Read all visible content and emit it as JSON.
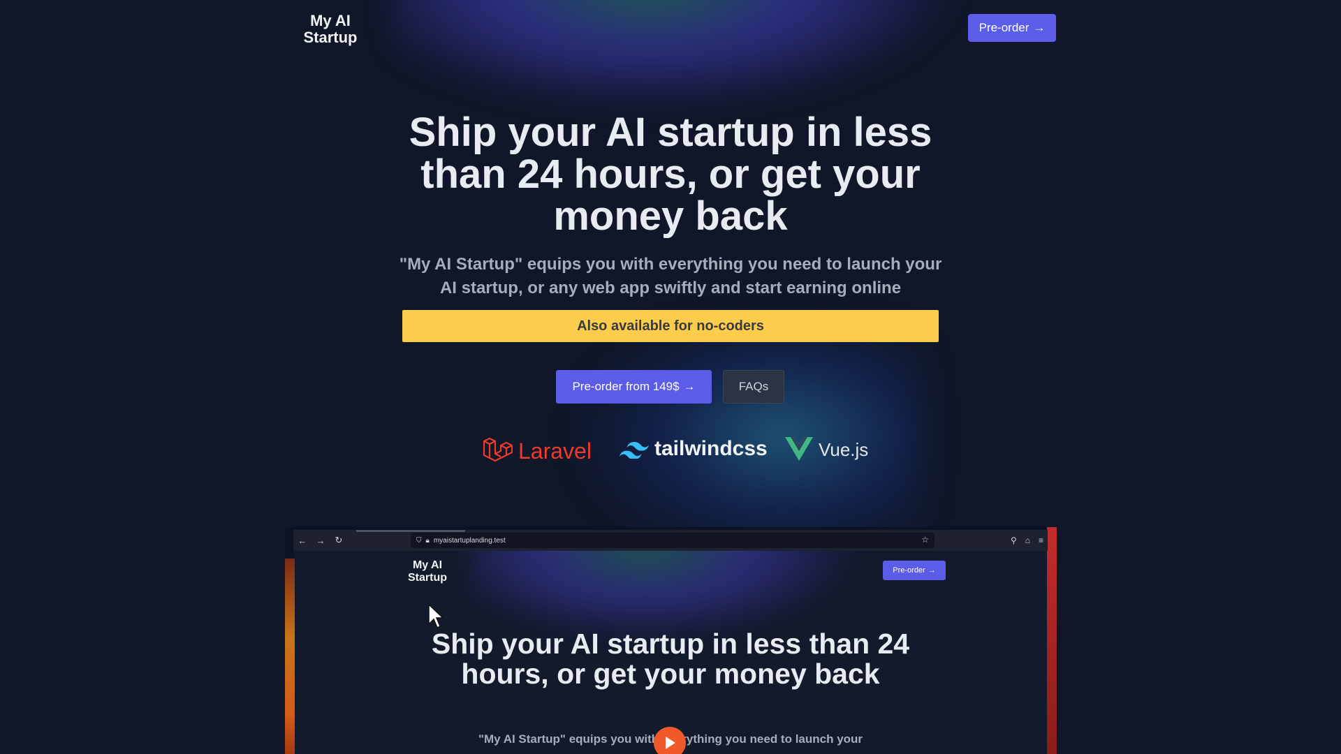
{
  "header": {
    "logo": "My AI Startup",
    "preorder_label": "Pre-order",
    "arrow": "→"
  },
  "hero": {
    "title": "Ship your AI startup in less than 24 hours, or get your money back",
    "subtitle": "\"My AI Startup\" equips you with everything you need to launch your AI startup, or any web app swiftly and start earning online",
    "nocoder_banner": "Also available for no-coders",
    "preorder_button": "Pre-order from 149$",
    "faq_button": "FAQs"
  },
  "tech_logos": [
    {
      "name": "Laravel",
      "icon": "laravel-icon",
      "color": "#ef3b2d"
    },
    {
      "name": "tailwindcss",
      "icon": "tailwind-icon",
      "color": "#38bdf8"
    },
    {
      "name": "Vue.js",
      "icon": "vue-icon",
      "color": "#41b883"
    }
  ],
  "video": {
    "url": "myaistartuplanding.test",
    "inner_logo": "My AI Startup",
    "inner_preorder": "Pre-order",
    "inner_title": "Ship your AI startup in less than 24 hours, or get your money back",
    "inner_subtitle": "\"My AI Startup\" equips you with everything you need to launch your"
  },
  "colors": {
    "background": "#0f1729",
    "accent": "#5b5ce8",
    "banner": "#fccd4d",
    "play": "#f05a2b"
  }
}
